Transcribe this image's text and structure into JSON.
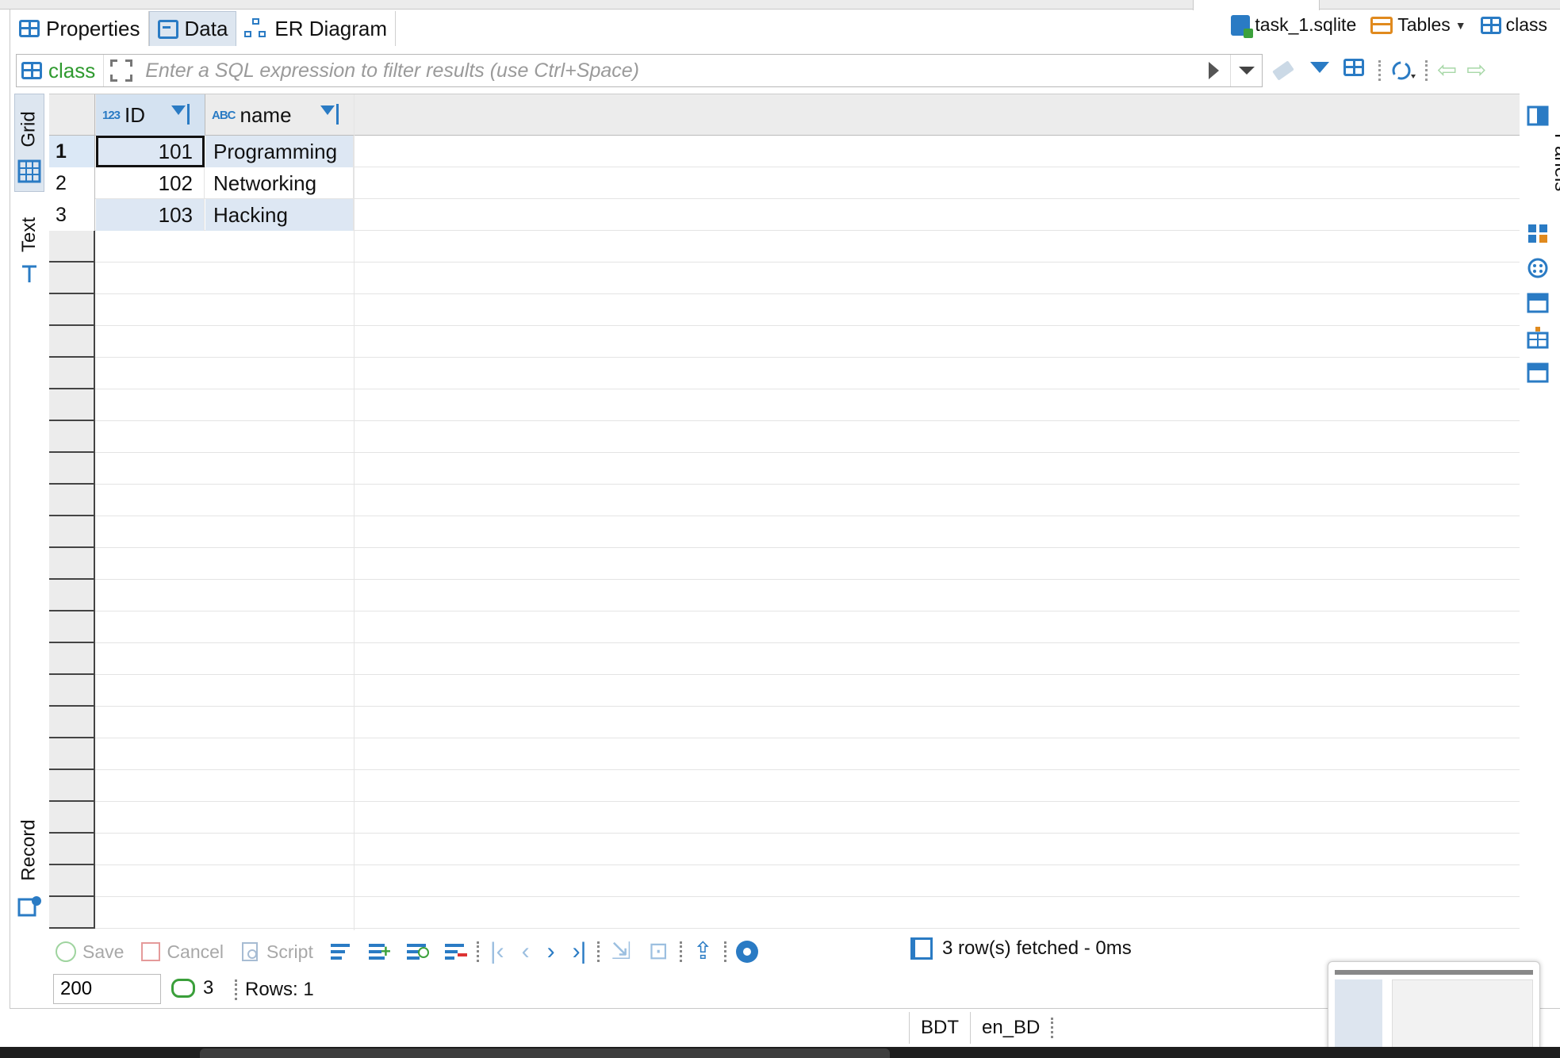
{
  "editor_tabs": [
    {
      "label": "Properties",
      "icon": "table-icon"
    },
    {
      "label": "Data",
      "icon": "data-icon"
    },
    {
      "label": "ER Diagram",
      "icon": "er-diagram-icon"
    }
  ],
  "breadcrumbs": {
    "datasource": "task_1.sqlite",
    "folder": "Tables",
    "entity": "class"
  },
  "filter": {
    "entity": "class",
    "placeholder": "Enter a SQL expression to filter results (use Ctrl+Space)"
  },
  "side_tabs": {
    "grid": "Grid",
    "text": "Text",
    "record": "Record"
  },
  "right_panel": {
    "label": "Panels"
  },
  "columns": [
    {
      "name": "ID",
      "type_badge": "123"
    },
    {
      "name": "name",
      "type_badge": "ABC"
    }
  ],
  "rows": [
    {
      "num": "1",
      "id": "101",
      "name": "Programming"
    },
    {
      "num": "2",
      "id": "102",
      "name": "Networking"
    },
    {
      "num": "3",
      "id": "103",
      "name": "Hacking"
    }
  ],
  "bottom_toolbar": {
    "save": "Save",
    "cancel": "Cancel",
    "script": "Script",
    "status": "3 row(s) fetched - 0ms"
  },
  "footer": {
    "fetch_size": "200",
    "refresh_count": "3",
    "rows_selected": "Rows: 1"
  },
  "status_bar": {
    "timezone": "BDT",
    "locale": "en_BD"
  },
  "colors": {
    "accent": "#2a7bc4",
    "entity_green": "#2f9a2f",
    "selection": "#dde7f3"
  }
}
